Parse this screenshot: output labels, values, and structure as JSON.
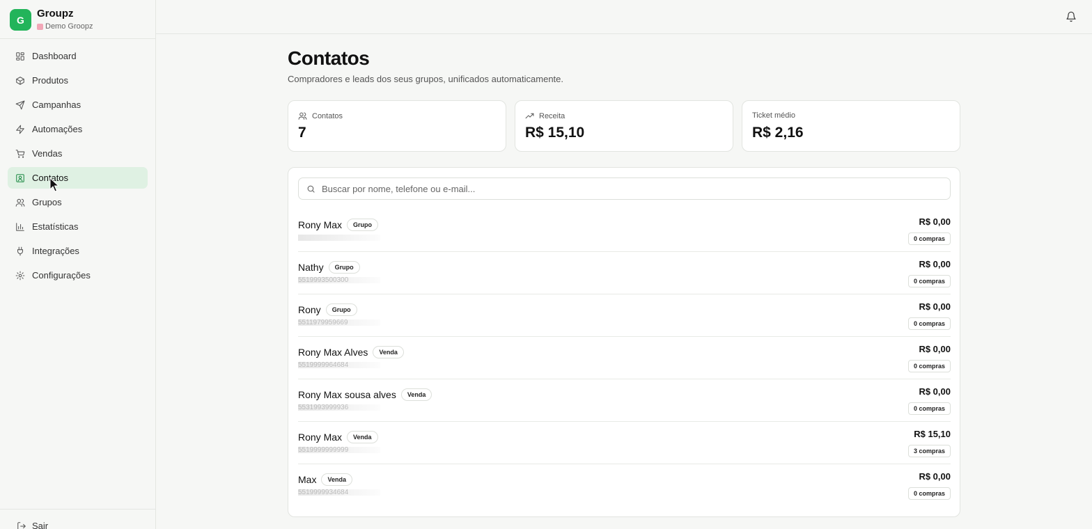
{
  "brand": {
    "logo_letter": "G",
    "name": "Groupz",
    "workspace": "Demo Groopz"
  },
  "nav": {
    "items": [
      {
        "label": "Dashboard",
        "icon": "layout-grid-icon",
        "active": false
      },
      {
        "label": "Produtos",
        "icon": "package-icon",
        "active": false
      },
      {
        "label": "Campanhas",
        "icon": "send-icon",
        "active": false
      },
      {
        "label": "Automações",
        "icon": "zap-icon",
        "active": false
      },
      {
        "label": "Vendas",
        "icon": "cart-icon",
        "active": false
      },
      {
        "label": "Contatos",
        "icon": "contact-icon",
        "active": true
      },
      {
        "label": "Grupos",
        "icon": "users-icon",
        "active": false
      },
      {
        "label": "Estatísticas",
        "icon": "bar-chart-icon",
        "active": false
      },
      {
        "label": "Integrações",
        "icon": "plug-icon",
        "active": false
      },
      {
        "label": "Configurações",
        "icon": "gear-icon",
        "active": false
      }
    ],
    "logout": "Sair"
  },
  "page": {
    "title": "Contatos",
    "subtitle": "Compradores e leads dos seus grupos, unificados automaticamente."
  },
  "stats": {
    "contacts": {
      "label": "Contatos",
      "value": "7"
    },
    "revenue": {
      "label": "Receita",
      "value": "R$ 15,10"
    },
    "ticket": {
      "label": "Ticket médio",
      "value": "R$ 2,16"
    }
  },
  "search": {
    "placeholder": "Buscar por nome, telefone ou e-mail...",
    "value": ""
  },
  "contacts": [
    {
      "name": "Rony Max",
      "badge": "Grupo",
      "phone": "",
      "amount": "R$ 0,00",
      "purchases": "0 compras"
    },
    {
      "name": "Nathy",
      "badge": "Grupo",
      "phone": "5519993500300",
      "amount": "R$ 0,00",
      "purchases": "0 compras"
    },
    {
      "name": "Rony",
      "badge": "Grupo",
      "phone": "5511979959669",
      "amount": "R$ 0,00",
      "purchases": "0 compras"
    },
    {
      "name": "Rony Max Alves",
      "badge": "Venda",
      "phone": "5519999964684",
      "amount": "R$ 0,00",
      "purchases": "0 compras"
    },
    {
      "name": "Rony Max sousa alves",
      "badge": "Venda",
      "phone": "5531993999936",
      "amount": "R$ 0,00",
      "purchases": "0 compras"
    },
    {
      "name": "Rony Max",
      "badge": "Venda",
      "phone": "5519999999999",
      "amount": "R$ 15,10",
      "purchases": "3 compras"
    },
    {
      "name": "Max",
      "badge": "Venda",
      "phone": "5519999934684",
      "amount": "R$ 0,00",
      "purchases": "0 compras"
    }
  ],
  "colors": {
    "brand_green": "#22b45a",
    "active_bg": "#dff1e3",
    "background": "#f6f7f5"
  }
}
